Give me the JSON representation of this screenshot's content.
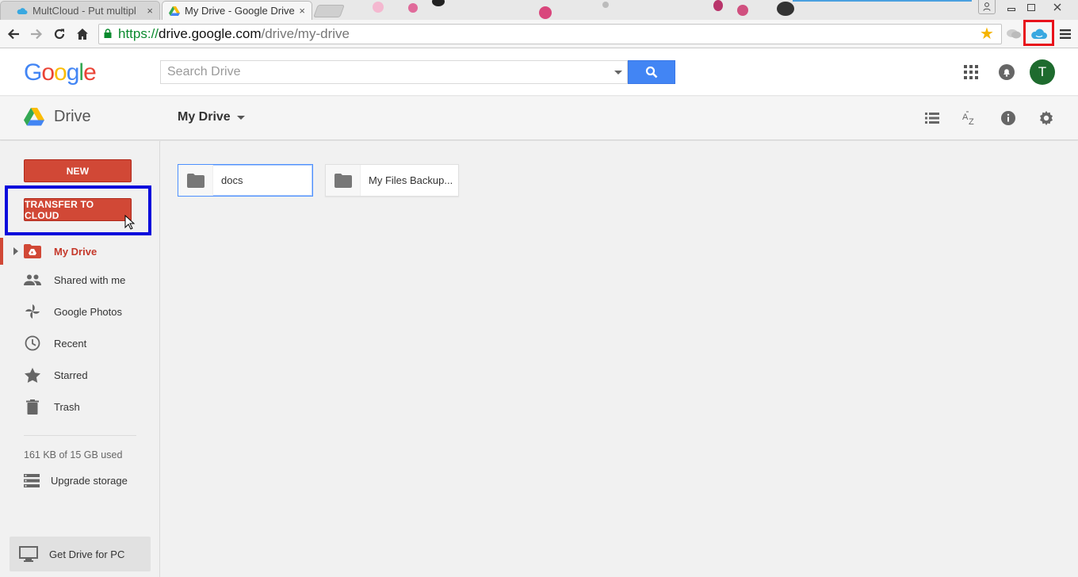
{
  "browser": {
    "tabs": [
      {
        "title": "MultCloud - Put multipl",
        "close": "×",
        "active": false
      },
      {
        "title": "My Drive - Google Drive",
        "close": "×",
        "active": true
      }
    ],
    "url": {
      "scheme": "https://",
      "host": "drive.google.com",
      "path": "/drive/my-drive"
    }
  },
  "header": {
    "logo_letters": [
      "G",
      "o",
      "o",
      "g",
      "l",
      "e"
    ],
    "logo_colors": [
      "#4285f4",
      "#ea4335",
      "#fbbc05",
      "#4285f4",
      "#34a853",
      "#ea4335"
    ],
    "search_placeholder": "Search Drive",
    "avatar_letter": "T"
  },
  "toolbar": {
    "brand": "Drive",
    "location": "My Drive"
  },
  "sidebar": {
    "new_label": "NEW",
    "transfer_label": "TRANSFER TO CLOUD",
    "items": [
      {
        "label": "My Drive",
        "icon": "my-drive-icon",
        "selected": true
      },
      {
        "label": "Shared with me",
        "icon": "people-icon"
      },
      {
        "label": "Google Photos",
        "icon": "pinwheel-icon"
      },
      {
        "label": "Recent",
        "icon": "clock-icon"
      },
      {
        "label": "Starred",
        "icon": "star-icon"
      },
      {
        "label": "Trash",
        "icon": "trash-icon"
      }
    ],
    "quota": "161 KB of 15 GB used",
    "upgrade_label": "Upgrade storage",
    "get_drive_label": "Get Drive for PC"
  },
  "main": {
    "folders": [
      {
        "name": "docs",
        "selected": true
      },
      {
        "name": "My Files Backup..."
      }
    ]
  },
  "colors": {
    "accent_red": "#d14836",
    "search_blue": "#4285f4",
    "highlight_blue_box": "#0a0adc",
    "highlight_red_box": "#e8121b",
    "avatar_green": "#1e6b2e"
  }
}
